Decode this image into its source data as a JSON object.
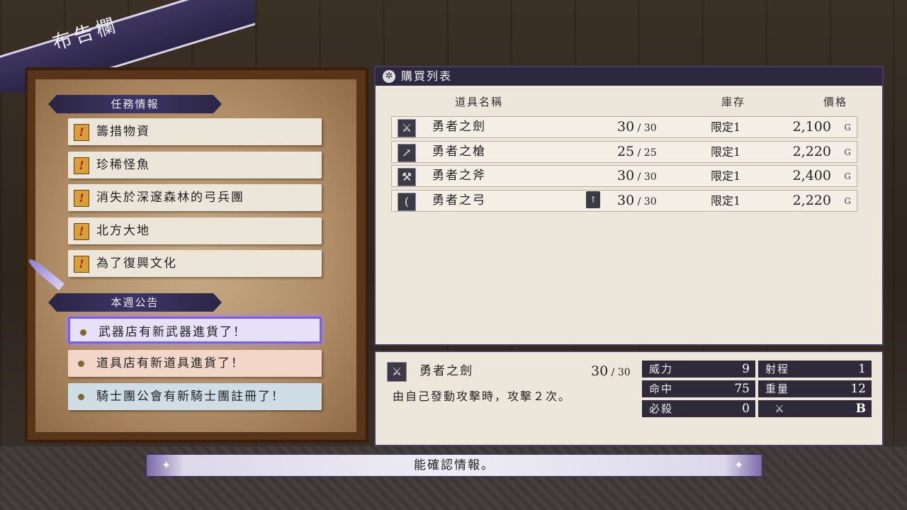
{
  "banner": {
    "title": "布告欄"
  },
  "quests": {
    "header": "任務情報",
    "items": [
      {
        "label": "籌措物資"
      },
      {
        "label": "珍稀怪魚"
      },
      {
        "label": "消失於深邃森林的弓兵團"
      },
      {
        "label": "北方大地"
      },
      {
        "label": "為了復興文化"
      }
    ],
    "icon_text": "!"
  },
  "notices": {
    "header": "本週公告",
    "items": [
      {
        "label": "武器店有新武器進貨了！",
        "color": "#e6e0f8"
      },
      {
        "label": "道具店有新道具進貨了！",
        "color": "#f2d6c8"
      },
      {
        "label": "騎士團公會有新騎士團註冊了！",
        "color": "#cfdde6"
      }
    ]
  },
  "purchase_list": {
    "title": "購買列表",
    "columns": {
      "name": "道具名稱",
      "stock": "庫存",
      "price": "價格"
    },
    "currency": "G",
    "items": [
      {
        "icon": "sword-icon",
        "name": "勇者之劍",
        "uses": "30",
        "max": "30",
        "stock": "限定1",
        "price": "2,100"
      },
      {
        "icon": "lance-icon",
        "name": "勇者之槍",
        "uses": "25",
        "max": "25",
        "stock": "限定1",
        "price": "2,220"
      },
      {
        "icon": "axe-icon",
        "name": "勇者之斧",
        "uses": "30",
        "max": "30",
        "stock": "限定1",
        "price": "2,400"
      },
      {
        "icon": "bow-icon",
        "name": "勇者之弓",
        "uses": "30",
        "max": "30",
        "stock": "限定1",
        "price": "2,220",
        "upgrade_icon": "quill-up-icon"
      }
    ]
  },
  "detail": {
    "name": "勇者之劍",
    "uses": "30",
    "max": "30",
    "description": "由自己發動攻擊時，攻擊２次。",
    "stats": {
      "might": {
        "label": "威力",
        "value": "9"
      },
      "range": {
        "label": "射程",
        "value": "1"
      },
      "hit": {
        "label": "命中",
        "value": "75"
      },
      "weight": {
        "label": "重量",
        "value": "12"
      },
      "crit": {
        "label": "必殺",
        "value": "0"
      },
      "rank": {
        "label": "",
        "value": "B"
      }
    }
  },
  "hint": {
    "text": "能確認情報。"
  }
}
